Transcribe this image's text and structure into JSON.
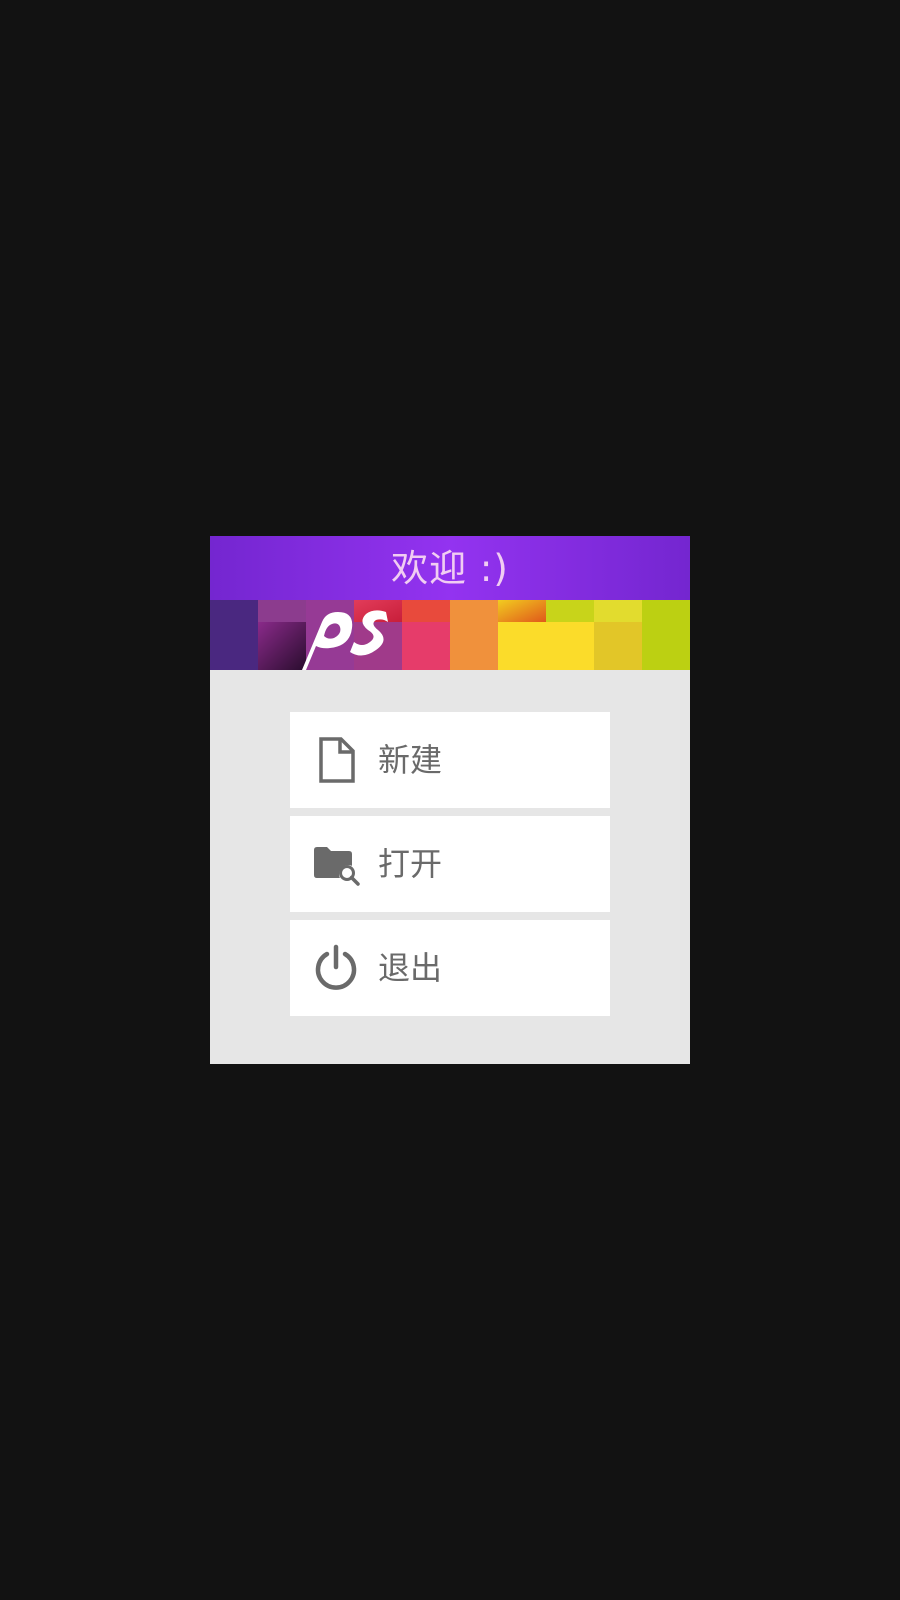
{
  "dialog": {
    "title": "欢迎 :)",
    "title_bar_color": "#8a2be8",
    "title_text_color": "#f1cdf2",
    "background_color": "#e6e6e6"
  },
  "banner": {
    "logo_text": "ps"
  },
  "menu": {
    "items": [
      {
        "label": "新建",
        "icon": "new-file-icon"
      },
      {
        "label": "打开",
        "icon": "open-folder-search-icon"
      },
      {
        "label": "退出",
        "icon": "power-icon"
      }
    ],
    "text_color": "#6a6a6a",
    "icon_color": "#6a6a6a"
  }
}
